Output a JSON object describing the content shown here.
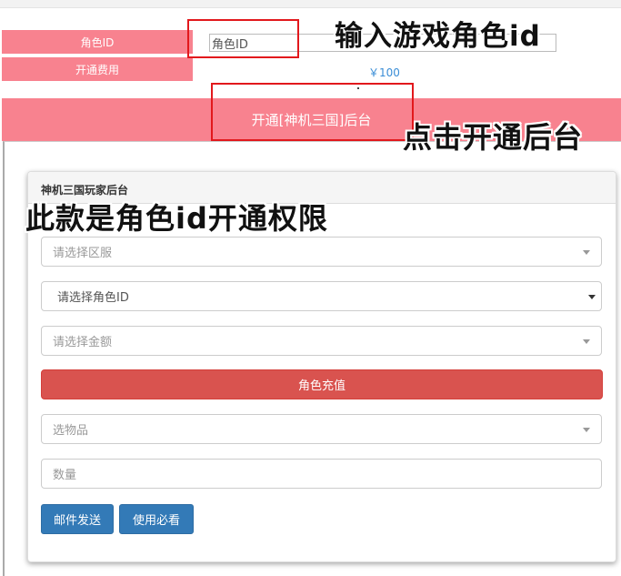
{
  "form": {
    "role_id_label": "角色ID",
    "role_id_value": "角色ID",
    "fee_label": "开通费用",
    "fee_value": "￥100",
    "open_button": "开通[神机三国]后台"
  },
  "annotations": {
    "enter_role_id": "输入游戏角色id",
    "click_open": "点击开通后台",
    "permission_note": "此款是角色id开通权限"
  },
  "panel": {
    "title": "神机三国玩家后台",
    "server_select_placeholder": "请选择区服",
    "role_select_placeholder": "请选择角色ID",
    "amount_select_placeholder": "请选择金额",
    "recharge_button": "角色充值",
    "item_select_placeholder": "选物品",
    "quantity_placeholder": "数量",
    "mail_button": "邮件发送",
    "guide_button": "使用必看"
  },
  "colors": {
    "label_bg": "#f8828f",
    "highlight_box": "#e2181c",
    "recharge_btn": "#d9534f",
    "primary_btn": "#337ab7",
    "fee_text": "#3a8dd6"
  }
}
